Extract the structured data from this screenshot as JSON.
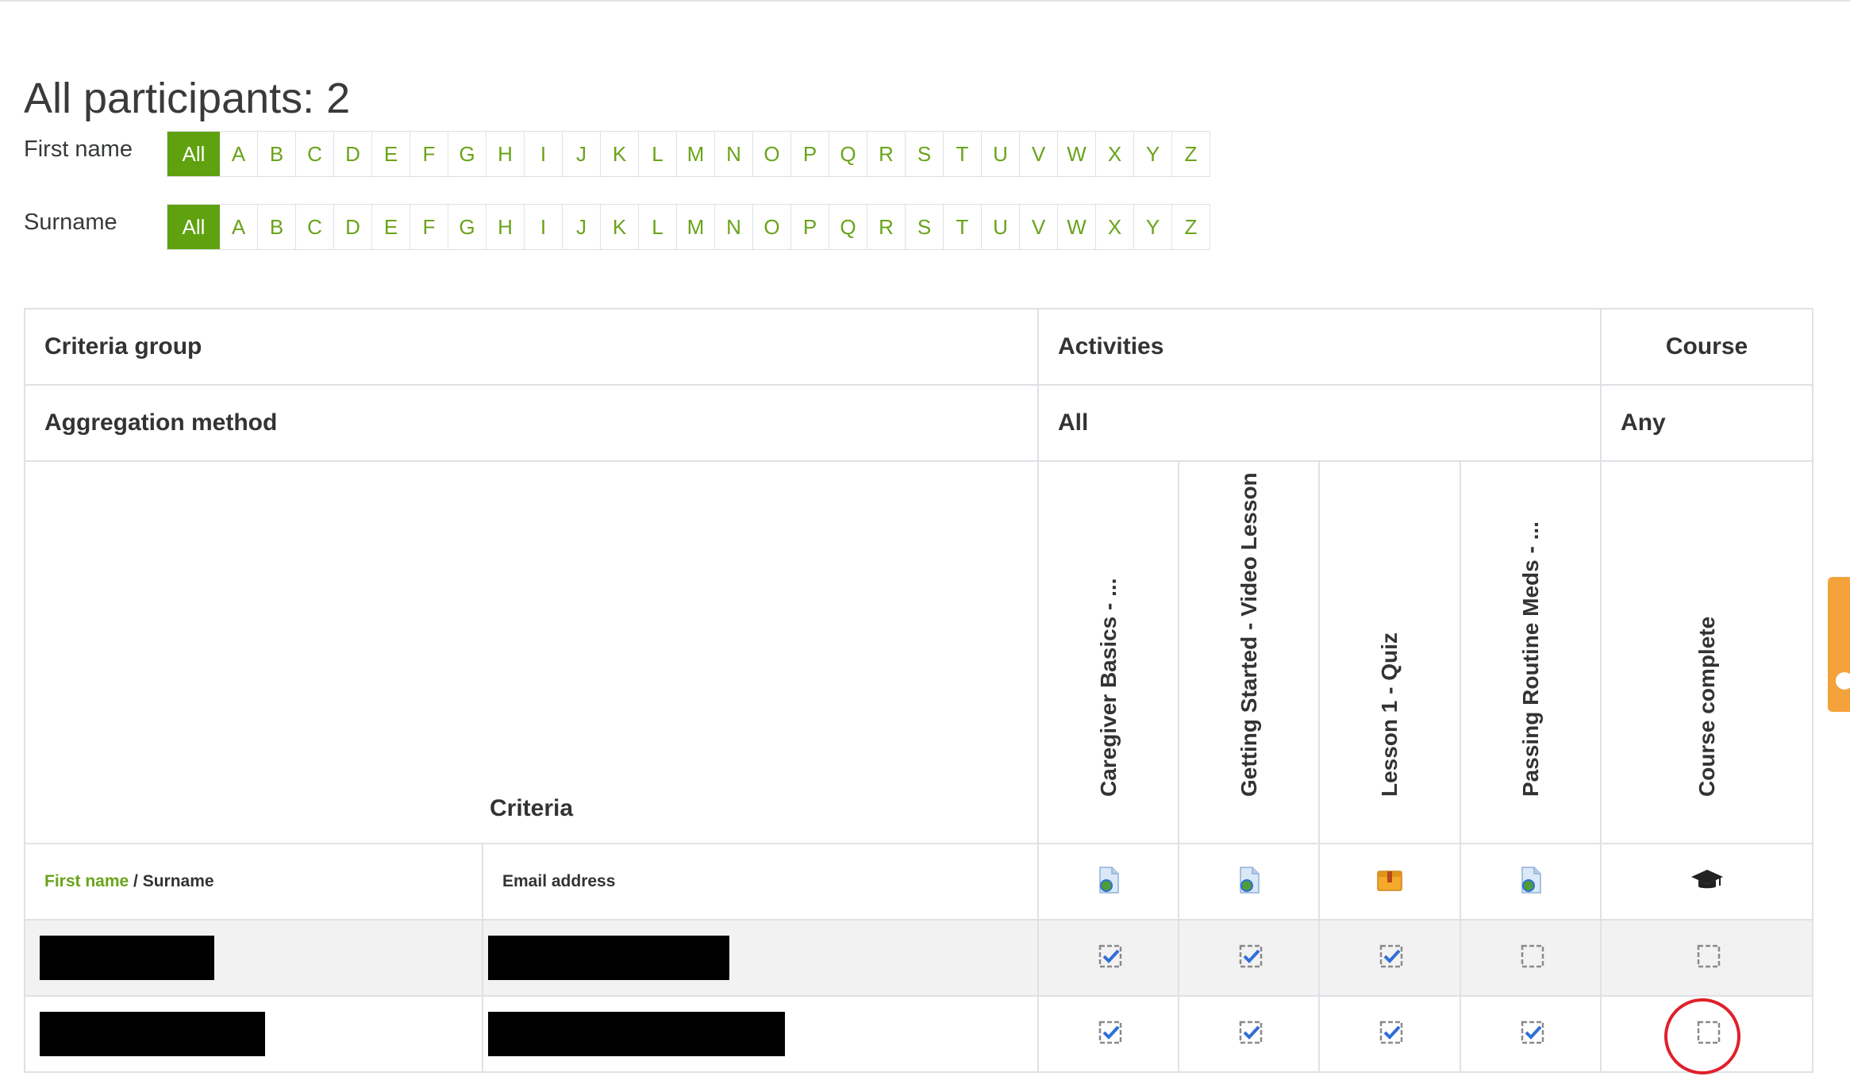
{
  "page": {
    "title": "All participants: 2"
  },
  "filters": {
    "first_name_label": "First name",
    "surname_label": "Surname",
    "letters": [
      "All",
      "A",
      "B",
      "C",
      "D",
      "E",
      "F",
      "G",
      "H",
      "I",
      "J",
      "K",
      "L",
      "M",
      "N",
      "O",
      "P",
      "Q",
      "R",
      "S",
      "T",
      "U",
      "V",
      "W",
      "X",
      "Y",
      "Z"
    ]
  },
  "table": {
    "criteria_group_label": "Criteria group",
    "activities_label": "Activities",
    "course_label": "Course",
    "aggregation_label": "Aggregation method",
    "aggregation_activities": "All",
    "aggregation_course": "Any",
    "criteria_label": "Criteria",
    "criteria_columns": [
      "Caregiver Basics - ...",
      "Getting Started - Video Lesson",
      "Lesson 1 - Quiz",
      "Passing Routine Meds - ...",
      "Course complete"
    ],
    "column_icons": [
      "page-icon",
      "page-icon",
      "quiz-box-icon",
      "page-icon",
      "graduation-cap-icon"
    ],
    "col_first_name": "First name",
    "col_separator": " / ",
    "col_surname": "Surname",
    "col_email": "Email address",
    "rows": [
      {
        "name_redacted": true,
        "email_redacted": true,
        "completion": [
          true,
          true,
          true,
          false,
          false
        ]
      },
      {
        "name_redacted": true,
        "email_redacted": true,
        "completion": [
          true,
          true,
          true,
          true,
          false
        ]
      }
    ]
  },
  "colors": {
    "accent": "#5fa10f",
    "link": "#6aa31a",
    "check_blue": "#2f6fd6",
    "highlight": "#e0202a",
    "side_tab": "#f4a23b"
  }
}
